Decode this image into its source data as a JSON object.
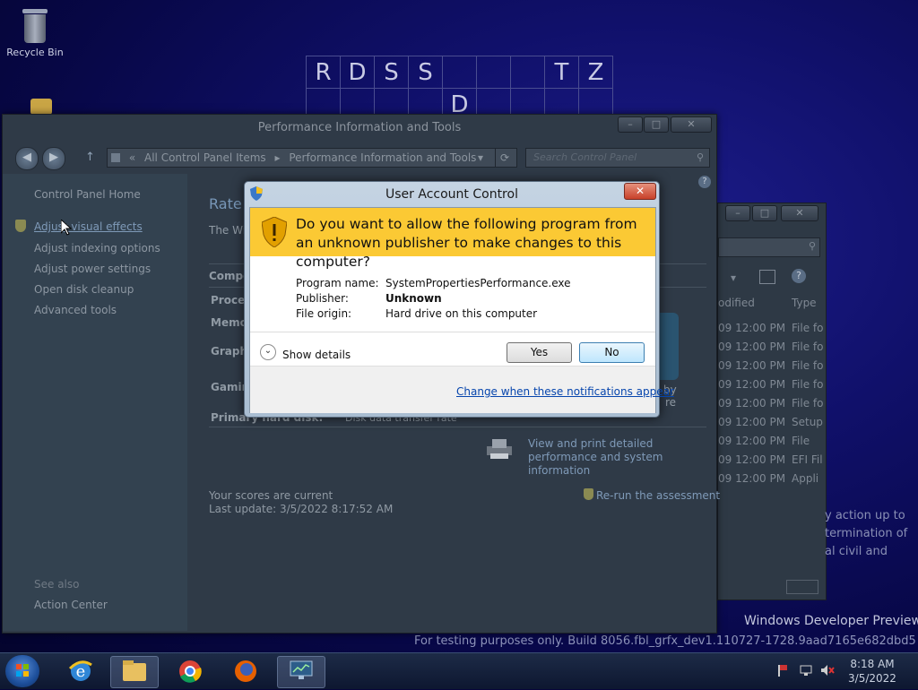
{
  "desktop": {
    "recycle_bin_label": "Recycle Bin",
    "puzzle_rows": [
      [
        "R",
        "D",
        "S",
        "S",
        "",
        "",
        "",
        "T",
        "Z"
      ],
      [
        "",
        "",
        "",
        "",
        "D",
        "",
        "",
        "",
        ""
      ]
    ],
    "watermark": {
      "line1": "Windows Developer Preview",
      "line2": "For testing purposes only. Build 8056.fbl_grfx_dev1.110727-1728.9aad7165e682dbd5"
    }
  },
  "main_window": {
    "title": "Performance Information and Tools",
    "breadcrumb": [
      "All Control Panel Items",
      "Performance Information and Tools"
    ],
    "search_placeholder": "Search Control Panel",
    "left_links": [
      "Control Panel Home",
      "Adjust visual effects",
      "Adjust indexing options",
      "Adjust power settings",
      "Open disk cleanup",
      "Advanced tools"
    ],
    "see_also_label": "See also",
    "see_also_links": [
      "Action Center"
    ],
    "heading_fragment": "Rate a",
    "desc_fragment": "The Wi",
    "component_header": "Compo",
    "component_rows": [
      "Proces",
      "Memo",
      "Graphi",
      "Gamin",
      "Primary hard disk:"
    ],
    "disk_subscore_text": "Disk data transfer rate",
    "detail_link": "View and print detailed performance and system information",
    "scores_current": "Your scores are current",
    "last_update": "Last update: 3/5/2022 8:17:52 AM",
    "rerun_link": "Re-run the assessment",
    "partial_by": "by",
    "partial_re": "re"
  },
  "second_window": {
    "column_modified": "odified",
    "column_type": "Type",
    "rows": [
      {
        "date": "09 12:00 PM",
        "type": "File fo"
      },
      {
        "date": "09 12:00 PM",
        "type": "File fo"
      },
      {
        "date": "09 12:00 PM",
        "type": "File fo"
      },
      {
        "date": "09 12:00 PM",
        "type": "File fo"
      },
      {
        "date": "09 12:00 PM",
        "type": "File fo"
      },
      {
        "date": "09 12:00 PM",
        "type": "Setup"
      },
      {
        "date": "09 12:00 PM",
        "type": "File"
      },
      {
        "date": "09 12:00 PM",
        "type": "EFI Fil"
      },
      {
        "date": "09 12:00 PM",
        "type": "Appli"
      }
    ],
    "partial_text": [
      "y action up to",
      "termination of",
      "al civil and"
    ]
  },
  "uac": {
    "title": "User Account Control",
    "question": "Do you want to allow the following program from an unknown publisher to make changes to this computer?",
    "program_label": "Program name:",
    "program_value": "SystemPropertiesPerformance.exe",
    "publisher_label": "Publisher:",
    "publisher_value": "Unknown",
    "origin_label": "File origin:",
    "origin_value": "Hard drive on this computer",
    "show_details": "Show details",
    "yes_label": "Yes",
    "no_label": "No",
    "change_link": "Change when these notifications appear"
  },
  "taskbar": {
    "time": "8:18 AM",
    "date": "3/5/2022"
  }
}
